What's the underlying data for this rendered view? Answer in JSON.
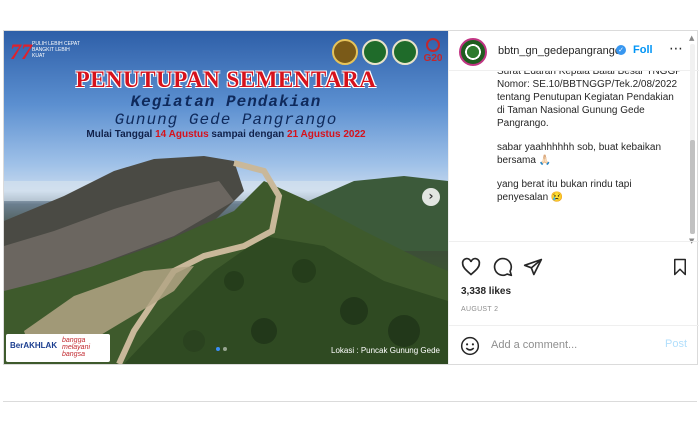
{
  "media": {
    "logo77_number": "77",
    "logo77_text": "PULIH LEBIH CEPAT BANGKIT LEBIH KUAT",
    "title_line1": "PENUTUPAN SEMENTARA",
    "title_line2": "Kegiatan Pendakian",
    "title_line3": "Gunung Gede Pangrango",
    "dates_prefix": "Mulai Tanggal ",
    "date_start": "14 Agustus",
    "dates_middle": " sampai dengan ",
    "date_end": "21 Agustus 2022",
    "berakhlak_label": "BerAKHLAK",
    "berakhlak_sub": "bangga melayani bangsa",
    "g20_label": "G20",
    "location_label": "Lokasi : Puncak Gunung Gede",
    "next_icon": "chevron-right-icon",
    "carousel_dots": 2
  },
  "header": {
    "username": "bbtn_gn_gedepangrango",
    "follow_label": "Foll",
    "verified_icon": "verified-badge-icon",
    "more_icon": "more-icon"
  },
  "caption": {
    "paragraph1": "Surat Edaran Kepala Balai Besar TNGGP Nomor: SE.10/BBTNGGP/Tek.2/08/2022 tentang Penutupan Kegiatan Pendakian di Taman Nasional Gunung Gede Pangrango.",
    "paragraph2": "sabar yaahhhhhh sob, buat kebaikan bersama 🙏🏻",
    "paragraph3": "yang berat itu bukan rindu tapi penyesalan 😢"
  },
  "actions": {
    "like_icon": "heart-icon",
    "comment_icon": "comment-icon",
    "share_icon": "share-icon",
    "save_icon": "bookmark-icon"
  },
  "likes": "3,338 likes",
  "post_date": "AUGUST 2",
  "comment": {
    "emoji_icon": "emoji-icon",
    "placeholder": "Add a comment...",
    "post_label": "Post"
  },
  "colors": {
    "accent_blue": "#0095f6",
    "post_disabled": "#b2dffc",
    "title_red": "#d6121c",
    "title_navy": "#0f2a5c"
  }
}
